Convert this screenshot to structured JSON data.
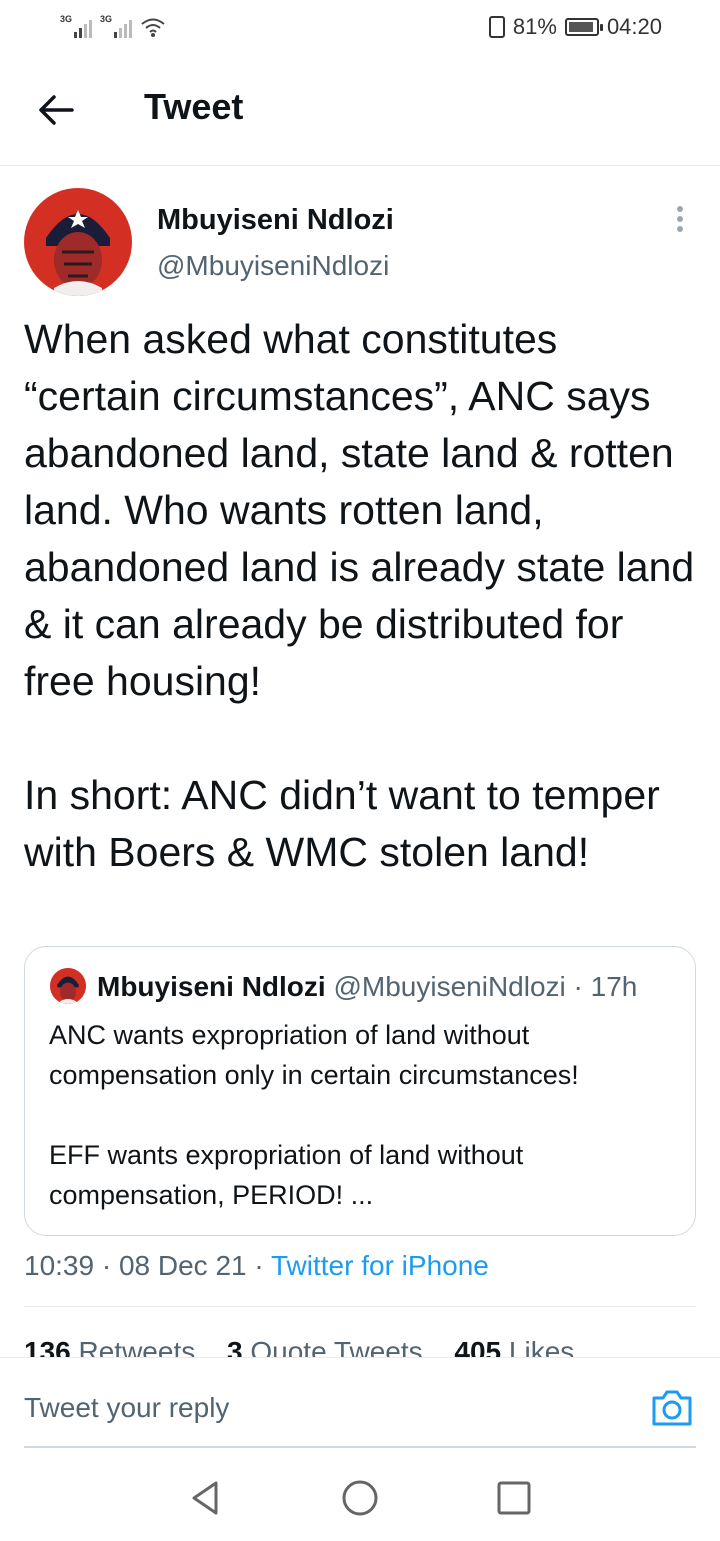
{
  "status_bar": {
    "network_1": "3G",
    "network_2": "3G",
    "battery_percent": "81%",
    "time": "04:20"
  },
  "header": {
    "title": "Tweet"
  },
  "tweet": {
    "author_name": "Mbuyiseni Ndlozi",
    "author_handle": "@MbuyiseniNdlozi",
    "paragraph_1": "When asked what constitutes “certain circumstances”, ANC says abandoned land, state land & rotten land. Who wants rotten land, abandoned land is already state land & it can already be distributed for free housing!",
    "paragraph_2": "In short: ANC didn’t want to temper with Boers & WMC stolen land!",
    "quote": {
      "author_name": "Mbuyiseni Ndlozi",
      "author_handle": "@MbuyiseniNdlozi",
      "age": "· 17h",
      "paragraph_1": "ANC wants expropriation of land without compensation only in certain circumstances!",
      "paragraph_2": "EFF wants expropriation of land without compensation, PERIOD! ..."
    },
    "timestamp": "10:39 · 08 Dec 21 ·",
    "source": "Twitter for iPhone",
    "stats": [
      {
        "count": "136",
        "label": "Retweets"
      },
      {
        "count": "3",
        "label": "Quote Tweets"
      },
      {
        "count": "405",
        "label": "Likes"
      }
    ]
  },
  "reply": {
    "placeholder": "Tweet your reply"
  },
  "colors": {
    "accent": "#1d9bf0",
    "secondary_text": "#536471",
    "divider": "#e6ecf0"
  }
}
